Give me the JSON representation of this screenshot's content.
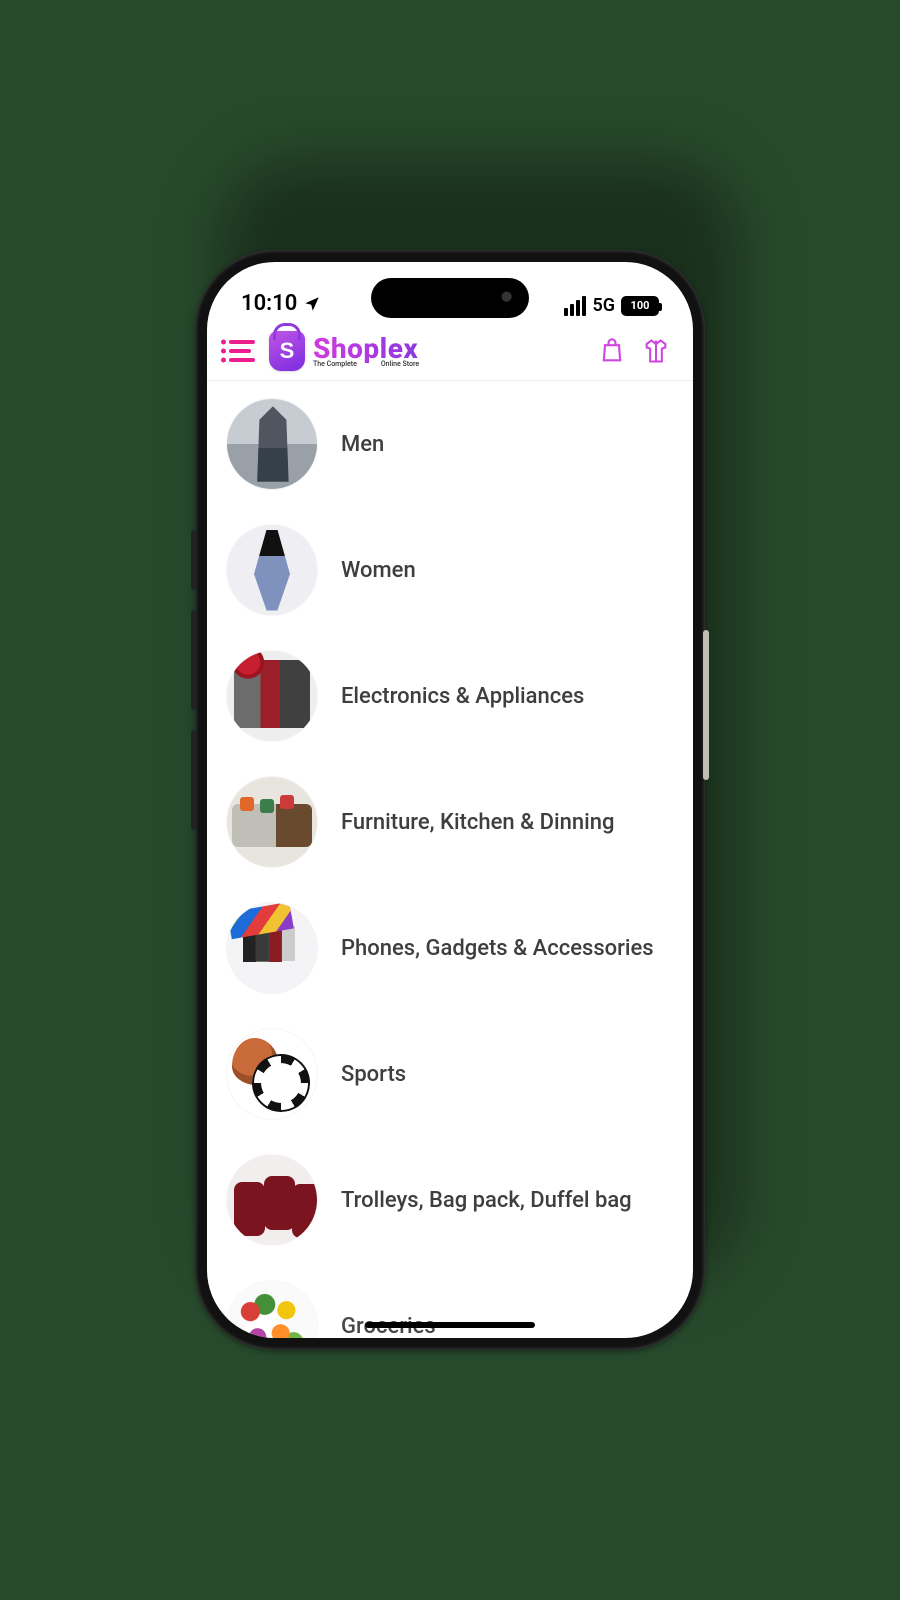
{
  "status": {
    "time": "10:10",
    "network": "5G",
    "battery": "100"
  },
  "header": {
    "brand": "Shoplex",
    "tagline_left": "The Complete",
    "tagline_right": "Online Store"
  },
  "categories": [
    {
      "key": "men",
      "label": "Men"
    },
    {
      "key": "women",
      "label": "Women"
    },
    {
      "key": "elec",
      "label": "Electronics & Appliances"
    },
    {
      "key": "furn",
      "label": "Furniture, Kitchen & Dinning"
    },
    {
      "key": "phones",
      "label": "Phones, Gadgets & Accessories"
    },
    {
      "key": "sports",
      "label": "Sports"
    },
    {
      "key": "trolley",
      "label": "Trolleys, Bag pack, Duffel bag"
    },
    {
      "key": "grocery",
      "label": "Groceries"
    }
  ]
}
